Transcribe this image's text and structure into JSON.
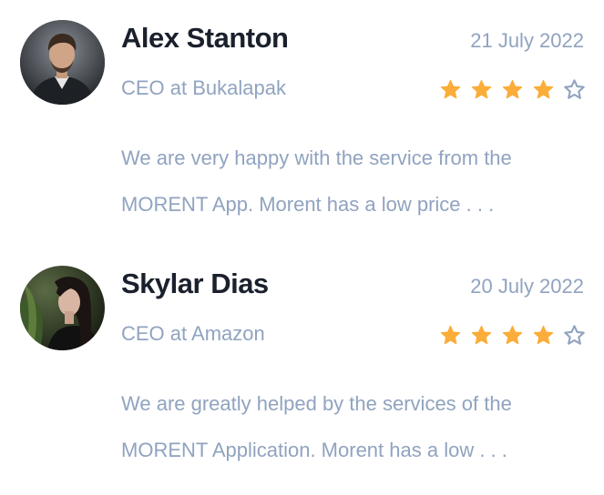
{
  "reviews": [
    {
      "name": "Alex Stanton",
      "role": "CEO at Bukalapak",
      "date": "21 July 2022",
      "rating": 4,
      "rating_max": 5,
      "text_line1": "We are very happy with the service from the",
      "text_line2": "MORENT App. Morent has a low price . . .",
      "avatar_icon": "man-portrait-photo"
    },
    {
      "name": "Skylar Dias",
      "role": "CEO at Amazon",
      "date": "20 July 2022",
      "rating": 4,
      "rating_max": 5,
      "text_line1": "We are greatly helped by the services of the",
      "text_line2": "MORENT Application. Morent has a low . . .",
      "avatar_icon": "woman-portrait-photo"
    }
  ],
  "colors": {
    "name": "#1a202c",
    "secondary": "#90a3bf",
    "star_filled": "#fbad39",
    "star_empty": "#90a3bf"
  }
}
